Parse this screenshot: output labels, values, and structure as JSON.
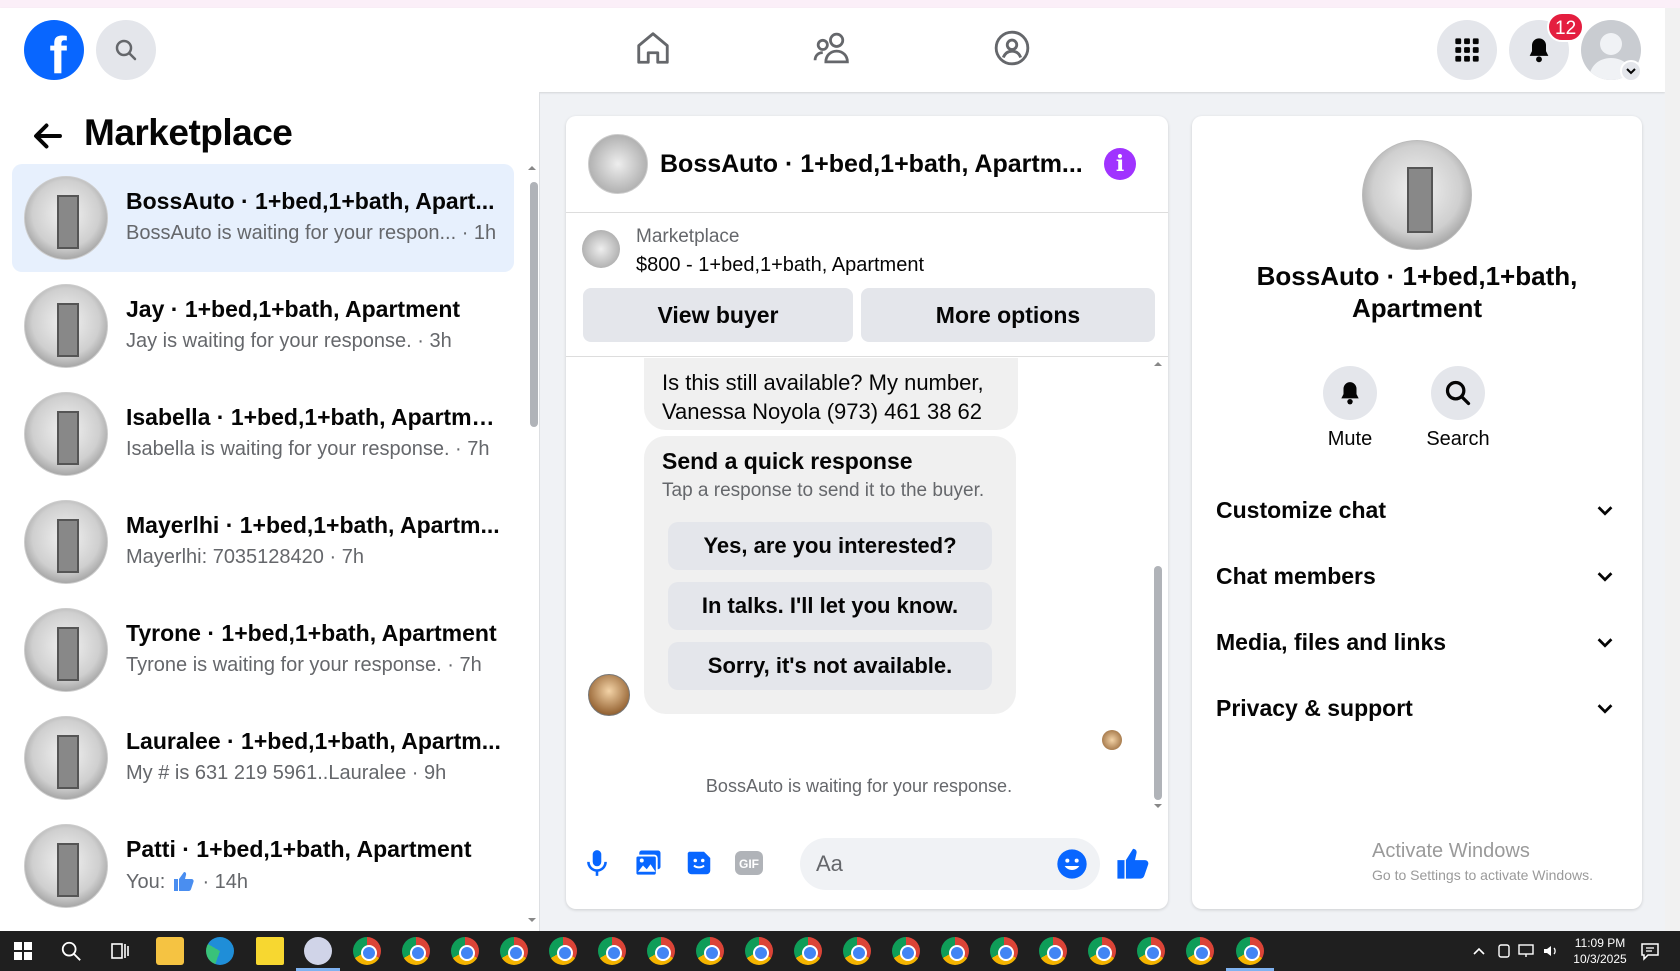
{
  "topbar": {
    "brand_letter": "f",
    "notification_count": "12"
  },
  "left": {
    "title": "Marketplace",
    "conversations": [
      {
        "name": "BossAuto · 1+bed,1+bath, Apart...",
        "preview": "BossAuto is waiting for your respon... · 1h",
        "active": true
      },
      {
        "name": "Jay · 1+bed,1+bath, Apartment",
        "preview": "Jay is waiting for your response. · 3h"
      },
      {
        "name": "Isabella · 1+bed,1+bath, Apartment",
        "preview": "Isabella is waiting for your response. · 7h"
      },
      {
        "name": "Mayerlhi · 1+bed,1+bath, Apartm...",
        "preview": "Mayerlhi: 7035128420 · 7h"
      },
      {
        "name": "Tyrone · 1+bed,1+bath, Apartment",
        "preview": "Tyrone is waiting for your response. · 7h"
      },
      {
        "name": "Lauralee · 1+bed,1+bath, Apartm...",
        "preview": "My # is 631 219 5961..Lauralee · 9h"
      },
      {
        "name": "Patti · 1+bed,1+bath, Apartment",
        "preview_prefix": "You:",
        "preview_suffix": "· 14h"
      }
    ]
  },
  "chat": {
    "title": "BossAuto · 1+bed,1+bath, Apartm...",
    "marketplace_label": "Marketplace",
    "listing": "$800 - 1+bed,1+bath, Apartment",
    "view_buyer": "View buyer",
    "more_options": "More options",
    "message": "Is this still available? My number, Vanessa Noyola  (973) 461 38 62",
    "quick_title": "Send a quick response",
    "quick_subtitle": "Tap a response to send it to the buyer.",
    "quick_responses": [
      "Yes, are you interested?",
      "In talks. I'll let you know.",
      "Sorry, it's not available."
    ],
    "waiting_text": "BossAuto is waiting for your response.",
    "input_placeholder": "Aa"
  },
  "right": {
    "name": "BossAuto · 1+bed,1+bath, Apartment",
    "mute": "Mute",
    "search": "Search",
    "sections": [
      "Customize chat",
      "Chat members",
      "Media, files and links",
      "Privacy & support"
    ],
    "activate_title": "Activate Windows",
    "activate_sub": "Go to Settings to activate Windows."
  },
  "taskbar": {
    "time": "11:09 PM",
    "date": "10/3/2025"
  },
  "colors": {
    "brand": "#0866ff",
    "badge": "#e41e3f",
    "info": "#a033ff",
    "messenger_blue": "#0866ff"
  }
}
